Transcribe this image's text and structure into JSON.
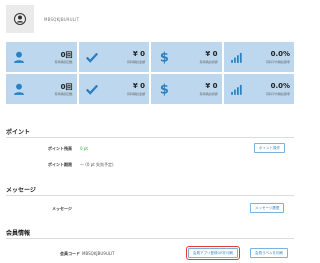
{
  "profile": {
    "member_id": "MBSQKJBU9ULIT",
    "avatar_icon": "user-icon"
  },
  "stats": [
    {
      "icon": "user-icon",
      "value": "0回",
      "sub": "有料購読回数"
    },
    {
      "icon": "check-icon",
      "value": "¥ 0",
      "sub": "有料購読金額"
    },
    {
      "icon": "dollar-icon",
      "value": "¥ 0",
      "sub": "有料購読総額"
    },
    {
      "icon": "signal-icon",
      "value": "0.0%",
      "sub": "有料平均購読確率"
    },
    {
      "icon": "user-icon",
      "value": "0回",
      "sub": "有料購読回数"
    },
    {
      "icon": "check-icon",
      "value": "¥ 0",
      "sub": "有料購読金額"
    },
    {
      "icon": "dollar-icon",
      "value": "¥ 0",
      "sub": "有料購読総額"
    },
    {
      "icon": "signal-icon",
      "value": "0.0%",
      "sub": "有料平均購読確率"
    }
  ],
  "point": {
    "title": "ポイント",
    "balance_label": "ポイント残高",
    "balance_value": "0 pt",
    "expire_label": "ポイント期限",
    "expire_value": "ー (0 pt 失効予定)",
    "operate_button": "ポイント操作"
  },
  "message": {
    "title": "メッセージ",
    "label": "メッセージ",
    "history_button": "メッセージ履歴"
  },
  "member": {
    "title": "会員情報",
    "code_label": "会員コード",
    "code_value": "MBSQKJBU9ULIT",
    "print_app_button": "会員アプリ登録QRを印刷",
    "print_label_button": "会員ラベルを印刷"
  },
  "colors": {
    "stat_bg": "#bdd8ee",
    "icon_blue": "#2b7fc3",
    "button_blue": "#3a86c8",
    "highlight_red": "#e43b3b"
  }
}
